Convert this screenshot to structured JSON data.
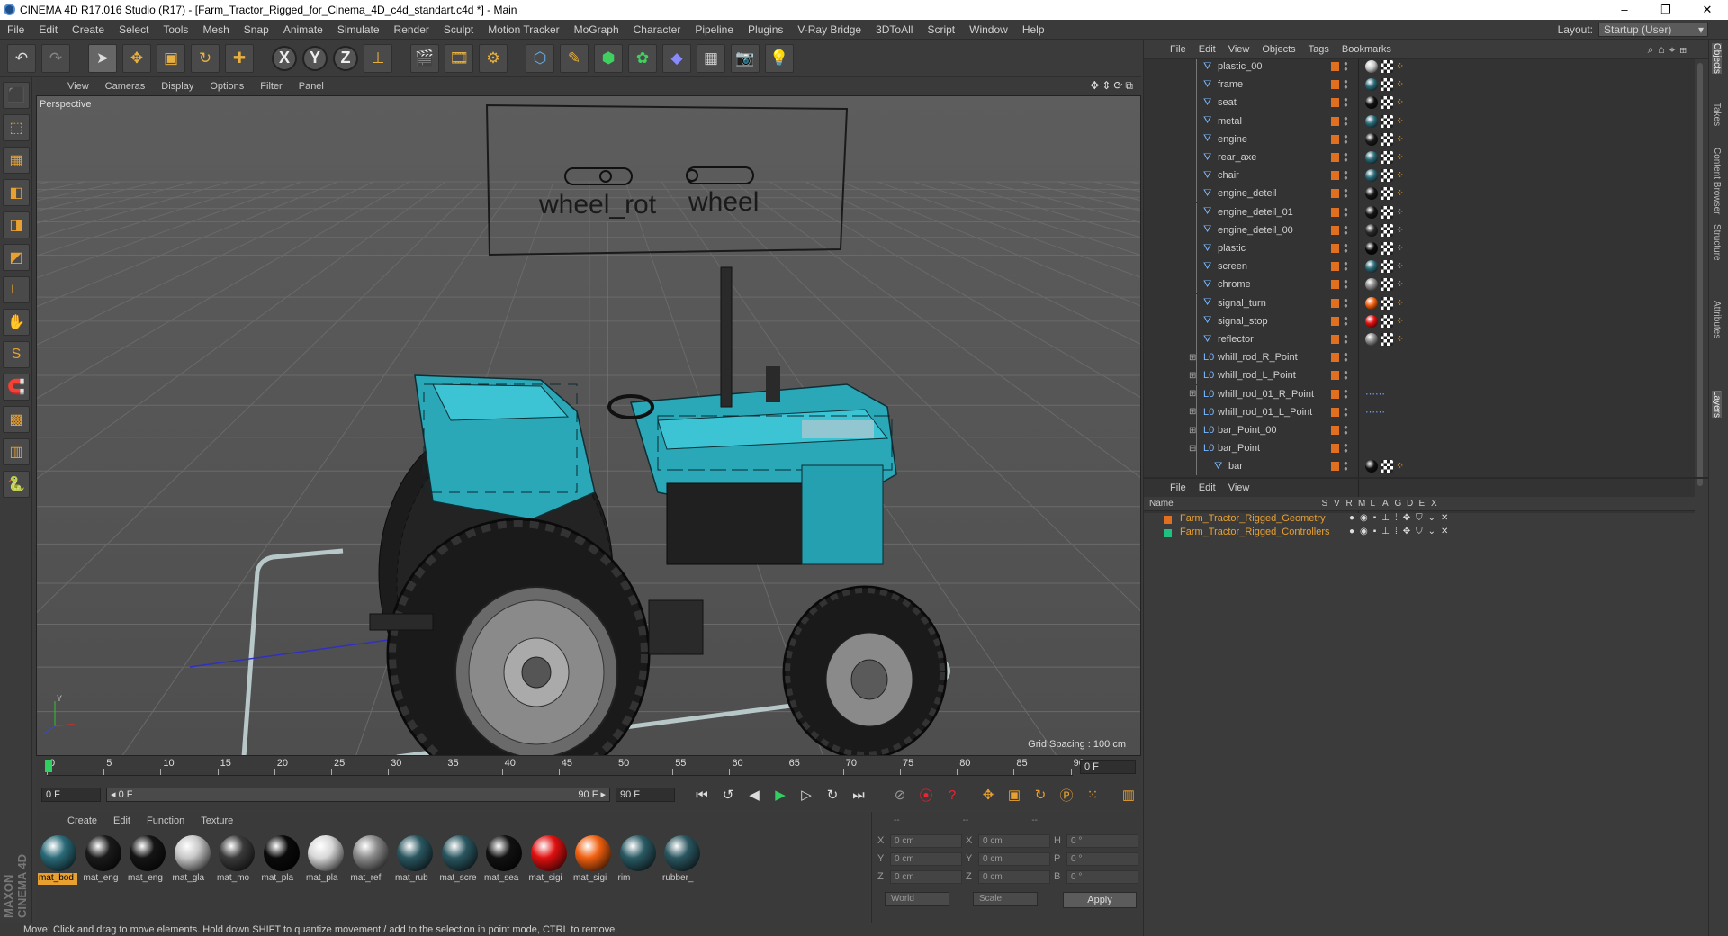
{
  "window": {
    "title": "CINEMA 4D R17.016 Studio (R17) - [Farm_Tractor_Rigged_for_Cinema_4D_c4d_standart.c4d *] - Main",
    "minimize": "–",
    "maximize": "❐",
    "close": "✕"
  },
  "menubar": [
    "File",
    "Edit",
    "Create",
    "Select",
    "Tools",
    "Mesh",
    "Snap",
    "Animate",
    "Simulate",
    "Render",
    "Sculpt",
    "Motion Tracker",
    "MoGraph",
    "Character",
    "Pipeline",
    "Plugins",
    "V-Ray Bridge",
    "3DToAll",
    "Script",
    "Window",
    "Help"
  ],
  "layout": {
    "label": "Layout:",
    "value": "Startup (User)"
  },
  "toolbar": {
    "undo": "↶",
    "redo": "↷",
    "select": "➤",
    "move": "✥",
    "scale": "▣",
    "rotate": "↻",
    "last": "✚",
    "axis_x": "X",
    "axis_y": "Y",
    "axis_z": "Z",
    "coord": "⊥",
    "render_view": "🎬",
    "render_pic": "🎞",
    "render_settings": "⚙",
    "cube": "⬡",
    "pen": "✎",
    "subdiv": "⬢",
    "array": "✿",
    "deformer": "◆",
    "floor": "▦",
    "camera": "📷",
    "light": "💡"
  },
  "lefttools": [
    "⬛",
    "⬚",
    "▦",
    "◧",
    "◨",
    "◩",
    "∟",
    "✋",
    "S",
    "🧲",
    "▩",
    "▥",
    "🐍"
  ],
  "viewport": {
    "menu": [
      "View",
      "Cameras",
      "Display",
      "Options",
      "Filter",
      "Panel"
    ],
    "nav_icons": "✥⇕⟳⧉",
    "label": "Perspective",
    "grid_spacing": "Grid Spacing : 100 cm",
    "controller_labels": [
      "wheel_rot",
      "wheel"
    ],
    "axis_y": "Y",
    "axis_x": "X",
    "axis_z": "Z"
  },
  "timeline": {
    "ticks": [
      "0",
      "5",
      "10",
      "15",
      "20",
      "25",
      "30",
      "35",
      "40",
      "45",
      "50",
      "55",
      "60",
      "65",
      "70",
      "75",
      "80",
      "85",
      "90"
    ],
    "frame_end": "0 F"
  },
  "transport": {
    "current": "0 F",
    "range_start": "◂ 0 F",
    "range_end": "90 F ▸",
    "max": "90 F",
    "buttons": [
      "⏮",
      "↺",
      "◀",
      "▶",
      "▷",
      "↻",
      "⏭"
    ]
  },
  "materials": {
    "menu": [
      "Create",
      "Edit",
      "Function",
      "Texture"
    ],
    "items": [
      {
        "label": "mat_bod",
        "color": "#2a6a78",
        "sel": true
      },
      {
        "label": "mat_eng",
        "color": "#1a1a1a"
      },
      {
        "label": "mat_eng",
        "color": "#151515"
      },
      {
        "label": "mat_gla",
        "color": "#c8c8c8"
      },
      {
        "label": "mat_mo",
        "color": "#3a3a3a"
      },
      {
        "label": "mat_pla",
        "color": "#0a0a0a"
      },
      {
        "label": "mat_pla",
        "color": "#d8d8d8"
      },
      {
        "label": "mat_refl",
        "color": "#8a8a8a"
      },
      {
        "label": "mat_rub",
        "color": "#2a5660"
      },
      {
        "label": "mat_scre",
        "color": "#2a5660"
      },
      {
        "label": "mat_sea",
        "color": "#111111"
      },
      {
        "label": "mat_sigi",
        "color": "#e01010"
      },
      {
        "label": "mat_sigi",
        "color": "#f06010"
      },
      {
        "label": "rim",
        "color": "#2a5a64"
      },
      {
        "label": "rubber_",
        "color": "#2a5660"
      }
    ]
  },
  "coords": {
    "headers": [
      "--",
      "--",
      "--"
    ],
    "rows": [
      {
        "a": "X",
        "av": "0 cm",
        "b": "X",
        "bv": "0 cm",
        "c": "H",
        "cv": "0 °"
      },
      {
        "a": "Y",
        "av": "0 cm",
        "b": "Y",
        "bv": "0 cm",
        "c": "P",
        "cv": "0 °"
      },
      {
        "a": "Z",
        "av": "0 cm",
        "b": "Z",
        "bv": "0 cm",
        "c": "B",
        "cv": "0 °"
      }
    ],
    "world": "World",
    "scale": "Scale",
    "apply": "Apply"
  },
  "status": "Move: Click and drag to move elements. Hold down SHIFT to quantize movement / add to the selection in point mode, CTRL to remove.",
  "objects": {
    "menu": [
      "File",
      "Edit",
      "View",
      "Objects",
      "Tags",
      "Bookmarks"
    ],
    "rows": [
      {
        "name": "plastic_00",
        "type": "poly",
        "mat": "#c8c8c8"
      },
      {
        "name": "frame",
        "type": "poly",
        "mat": "#2a6a78"
      },
      {
        "name": "seat",
        "type": "poly",
        "mat": "#111111"
      },
      {
        "name": "metal",
        "type": "poly",
        "mat": "#2a6a78"
      },
      {
        "name": "engine",
        "type": "poly",
        "mat": "#1a1a1a"
      },
      {
        "name": "rear_axe",
        "type": "poly",
        "mat": "#2a6a78"
      },
      {
        "name": "chair",
        "type": "poly",
        "mat": "#2a6a78"
      },
      {
        "name": "engine_deteil",
        "type": "poly",
        "mat": "#151515"
      },
      {
        "name": "engine_deteil_01",
        "type": "poly",
        "mat": "#151515"
      },
      {
        "name": "engine_deteil_00",
        "type": "poly",
        "mat": "#2a2a2a"
      },
      {
        "name": "plastic",
        "type": "poly",
        "mat": "#0a0a0a"
      },
      {
        "name": "screen",
        "type": "poly",
        "mat": "#2a6a78"
      },
      {
        "name": "chrome",
        "type": "poly",
        "mat": "#8a8a8a"
      },
      {
        "name": "signal_turn",
        "type": "poly",
        "mat": "#f06010"
      },
      {
        "name": "signal_stop",
        "type": "poly",
        "mat": "#e01010"
      },
      {
        "name": "reflector",
        "type": "poly",
        "mat": "#8a8a8a"
      },
      {
        "name": "whill_rod_R_Point",
        "type": "null",
        "mat": ""
      },
      {
        "name": "whill_rod_L_Point",
        "type": "null",
        "mat": ""
      },
      {
        "name": "whill_rod_01_R_Point",
        "type": "null",
        "mat": "ik"
      },
      {
        "name": "whill_rod_01_L_Point",
        "type": "null",
        "mat": "ik"
      },
      {
        "name": "bar_Point_00",
        "type": "null",
        "mat": ""
      },
      {
        "name": "bar_Point",
        "type": "null",
        "mat": ""
      },
      {
        "name": "bar",
        "type": "poly",
        "mat": "#111111"
      }
    ]
  },
  "layers": {
    "menu": [
      "File",
      "Edit",
      "View"
    ],
    "headers": [
      "Name",
      "S",
      "V",
      "R",
      "M",
      "L",
      "A",
      "G",
      "D",
      "E",
      "X"
    ],
    "rows": [
      {
        "name": "Farm_Tractor_Rigged_Geometry",
        "color": "#e07020"
      },
      {
        "name": "Farm_Tractor_Rigged_Controllers",
        "color": "#20c080"
      }
    ]
  },
  "sidetabs": [
    "Objects",
    "Takes",
    "Content Browser",
    "Structure",
    "Attributes",
    "Layers"
  ],
  "brand": "MAXON CINEMA 4D"
}
